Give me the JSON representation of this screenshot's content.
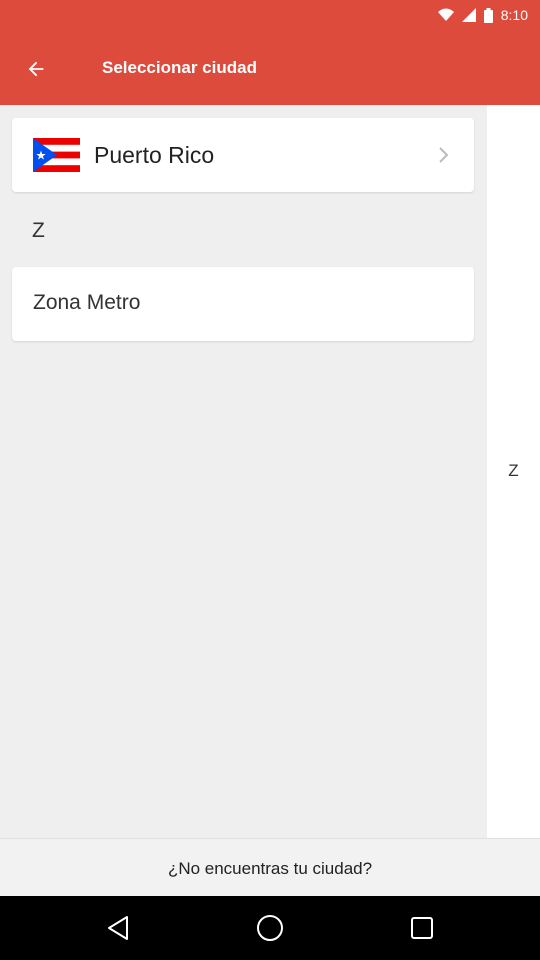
{
  "status_bar": {
    "time": "8:10"
  },
  "app_bar": {
    "title": "Seleccionar ciudad"
  },
  "country": {
    "name": "Puerto Rico"
  },
  "sections": [
    {
      "letter": "Z",
      "cities": [
        "Zona Metro"
      ]
    }
  ],
  "index": {
    "letters": [
      "Z"
    ]
  },
  "footer": {
    "link": "¿No encuentras tu ciudad?"
  },
  "colors": {
    "primary": "#dd4b3c",
    "background": "#efefef"
  }
}
